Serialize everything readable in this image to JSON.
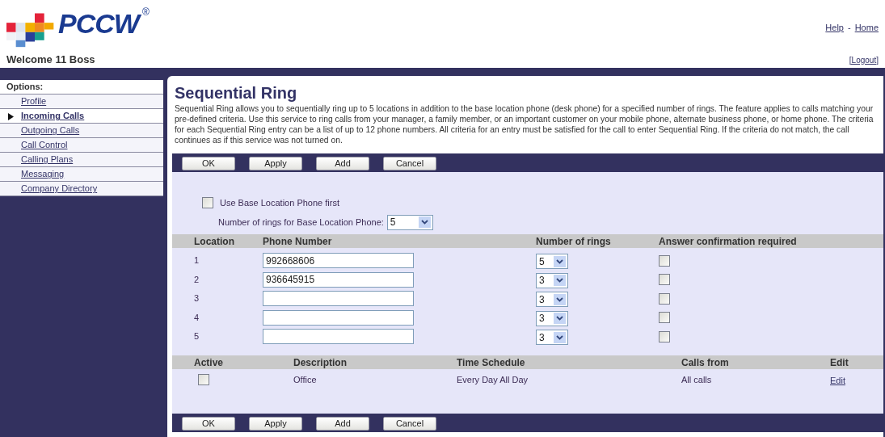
{
  "header": {
    "logo_text": "PCCW",
    "logo_mark": "®",
    "links": [
      {
        "kind": "link",
        "label": "Help"
      },
      {
        "kind": "separator",
        "label": "-"
      },
      {
        "kind": "link",
        "label": "Home"
      }
    ],
    "welcome": "Welcome 11 Boss",
    "logout": "[Logout]"
  },
  "sidebar": {
    "heading": "Options:",
    "items": [
      {
        "label": "Profile",
        "selected": false
      },
      {
        "label": "Incoming Calls",
        "selected": true
      },
      {
        "label": "Outgoing Calls",
        "selected": false
      },
      {
        "label": "Call Control",
        "selected": false
      },
      {
        "label": "Calling Plans",
        "selected": false
      },
      {
        "label": "Messaging",
        "selected": false
      },
      {
        "label": "Company Directory",
        "selected": false
      }
    ]
  },
  "main": {
    "title": "Sequential Ring",
    "description": "Sequential Ring allows you to sequentially ring up to 5 locations in addition to the base location phone (desk phone) for a specified number of rings. The feature applies to calls matching your pre-defined criteria. Use this service to ring calls from your manager, a family member, or an important customer on your mobile phone, alternate business phone, or home phone. The criteria for each Sequential Ring entry can be a list of up to 12 phone numbers. All criteria for an entry must be satisfied for the call to enter Sequential Ring. If the criteria do not match, the call continues as if this service was not turned on.",
    "top_buttons": [
      "OK",
      "Apply",
      "Add",
      "Cancel"
    ],
    "base_phone": {
      "label": "Use Base Location Phone first",
      "checked": false
    },
    "base_rings": {
      "label": "Number of rings for Base Location Phone:",
      "value": "5"
    },
    "locations": {
      "columns": [
        "Location",
        "Phone Number",
        "Number of rings",
        "Answer confirmation required"
      ],
      "rows": [
        {
          "location": "1",
          "phone": "992668606",
          "rings": "5",
          "confirm": false
        },
        {
          "location": "2",
          "phone": "936645915",
          "rings": "3",
          "confirm": false
        },
        {
          "location": "3",
          "rings": "3",
          "confirm": false
        },
        {
          "location": "4",
          "rings": "3",
          "confirm": false
        },
        {
          "location": "5",
          "rings": "3",
          "confirm": false
        }
      ]
    },
    "criteria": {
      "columns": [
        "Active",
        "Description",
        "Time Schedule",
        "Calls from",
        "Edit"
      ],
      "rows": [
        {
          "active": false,
          "description": "Office",
          "schedule": "Every Day All Day",
          "calls_from": "All calls",
          "edit": "Edit"
        }
      ]
    },
    "bottom_buttons": [
      "OK",
      "Apply",
      "Add",
      "Cancel"
    ]
  }
}
